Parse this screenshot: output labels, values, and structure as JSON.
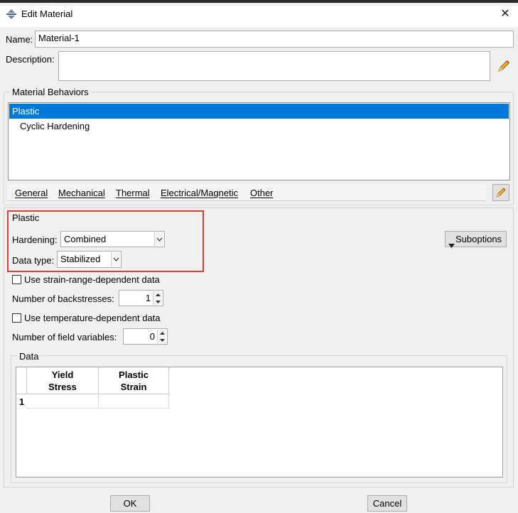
{
  "window": {
    "title": "Edit Material",
    "close_glyph": "✕"
  },
  "name_field": {
    "label": "Name:",
    "value": "Material-1"
  },
  "description_field": {
    "label": "Description:",
    "value": ""
  },
  "behaviors": {
    "title": "Material Behaviors",
    "items": [
      {
        "label": "Plastic",
        "selected": true
      },
      {
        "label": "Cyclic Hardening",
        "selected": false
      }
    ],
    "menu": [
      {
        "label": "General",
        "accel_index": 0
      },
      {
        "label": "Mechanical",
        "accel_index": 0
      },
      {
        "label": "Thermal",
        "accel_index": 0
      },
      {
        "label": "Electrical/Magnetic",
        "accel_index": 0
      },
      {
        "label": "Other",
        "accel_index": 0
      }
    ]
  },
  "plastic": {
    "title": "Plastic",
    "hardening_label": "Hardening:",
    "hardening_value": "Combined",
    "datatype_label": "Data type:",
    "datatype_value": "Stabilized",
    "suboptions_label": "Suboptions",
    "strain_range_label": "Use strain-range-dependent data",
    "strain_range_checked": false,
    "backstresses_label": "Number of backstresses:",
    "backstresses_value": "1",
    "temperature_label": "Use temperature-dependent data",
    "temperature_checked": false,
    "field_vars_label": "Number of field variables:",
    "field_vars_value": "0"
  },
  "data_table": {
    "title": "Data",
    "columns": [
      {
        "line1": "Yield",
        "line2": "Stress"
      },
      {
        "line1": "Plastic",
        "line2": "Strain"
      }
    ],
    "rows": [
      {
        "index": "1",
        "cells": [
          "",
          ""
        ]
      }
    ]
  },
  "footer": {
    "ok_label": "OK",
    "cancel_label": "Cancel"
  },
  "colors": {
    "selection": "#0078d7",
    "highlight": "#d9403a"
  }
}
